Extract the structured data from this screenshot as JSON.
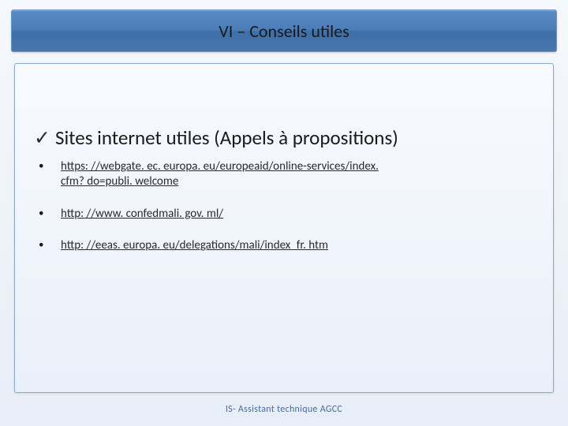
{
  "title": "VI – Conseils utiles",
  "heading": "Sites internet utiles (Appels à propositions)",
  "links": [
    "https: //webgate. ec. europa. eu/europeaid/online-services/index. cfm? do=publi. welcome",
    "http: //www. confedmali. gov. ml/",
    "http: //eeas. europa. eu/delegations/mali/index_fr. htm"
  ],
  "footer": "IS- Assistant technique AGCC"
}
